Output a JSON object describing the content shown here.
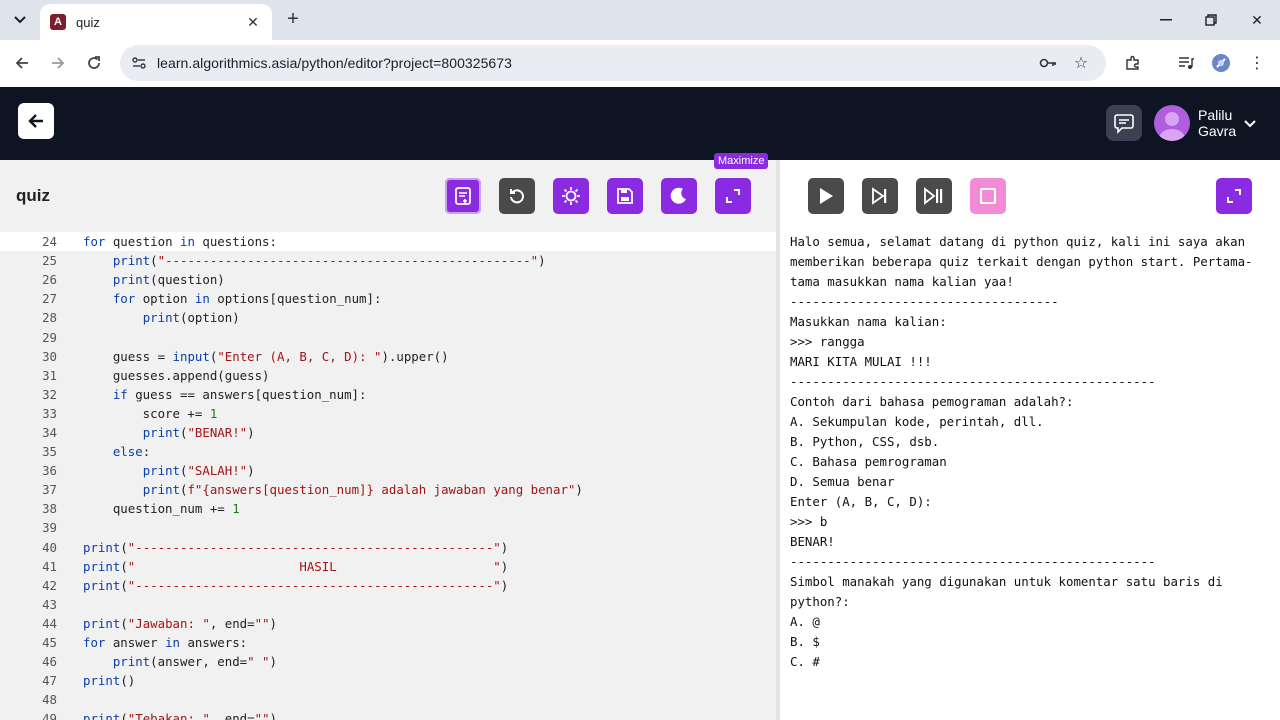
{
  "browser": {
    "tab_title": "quiz",
    "favicon_letter": "A",
    "url": "learn.algorithmics.asia/python/editor?project=800325673"
  },
  "header": {
    "user_first": "Palilu",
    "user_last": "Gavra"
  },
  "editor": {
    "project_name": "quiz",
    "tooltip": "Maximize",
    "tools": [
      "docs-icon",
      "reset-icon",
      "debug-icon",
      "save-icon",
      "theme-icon",
      "maximize-icon"
    ]
  },
  "code_lines": [
    {
      "n": "24",
      "t": "for question in questions:"
    },
    {
      "n": "25",
      "t": "    print(\"-------------------------------------------------\")"
    },
    {
      "n": "26",
      "t": "    print(question)"
    },
    {
      "n": "27",
      "t": "    for option in options[question_num]:"
    },
    {
      "n": "28",
      "t": "        print(option)"
    },
    {
      "n": "29",
      "t": ""
    },
    {
      "n": "30",
      "t": "    guess = input(\"Enter (A, B, C, D): \").upper()"
    },
    {
      "n": "31",
      "t": "    guesses.append(guess)"
    },
    {
      "n": "32",
      "t": "    if guess == answers[question_num]:"
    },
    {
      "n": "33",
      "t": "        score += 1"
    },
    {
      "n": "34",
      "t": "        print(\"BENAR!\")"
    },
    {
      "n": "35",
      "t": "    else:"
    },
    {
      "n": "36",
      "t": "        print(\"SALAH!\")"
    },
    {
      "n": "37",
      "t": "        print(f\"{answers[question_num]} adalah jawaban yang benar\")"
    },
    {
      "n": "38",
      "t": "    question_num += 1"
    },
    {
      "n": "39",
      "t": ""
    },
    {
      "n": "40",
      "t": "print(\"------------------------------------------------\")"
    },
    {
      "n": "41",
      "t": "print(\"                      HASIL                     \")"
    },
    {
      "n": "42",
      "t": "print(\"------------------------------------------------\")"
    },
    {
      "n": "43",
      "t": ""
    },
    {
      "n": "44",
      "t": "print(\"Jawaban: \", end=\"\")"
    },
    {
      "n": "45",
      "t": "for answer in answers:"
    },
    {
      "n": "46",
      "t": "    print(answer, end=\" \")"
    },
    {
      "n": "47",
      "t": "print()"
    },
    {
      "n": "48",
      "t": ""
    },
    {
      "n": "49",
      "t": "print(\"Tebakan: \", end=\"\")"
    }
  ],
  "console_lines": [
    "Halo semua, selamat datang di python quiz, kali ini saya akan",
    "memberikan beberapa quiz terkait dengan python start. Pertama-",
    "tama masukkan nama kalian yaa!",
    "------------------------------------",
    "Masukkan nama kalian:",
    ">>> rangga",
    "MARI KITA MULAI !!!",
    "-------------------------------------------------",
    "Contoh dari bahasa pemograman adalah?:",
    "A. Sekumpulan kode, perintah, dll.",
    "B. Python, CSS, dsb.",
    "C. Bahasa pemrograman",
    "D. Semua benar",
    "Enter (A, B, C, D):",
    ">>> b",
    "BENAR!",
    "-------------------------------------------------",
    "Simbol manakah yang digunakan untuk komentar satu baris di",
    "python?:",
    "A. @",
    "B. $",
    "C. #"
  ],
  "colors": {
    "accent": "#8a2be2",
    "header_bg": "#0e1422",
    "stop_button": "#f28ad6",
    "run_buttons": "#4a4a4a"
  }
}
